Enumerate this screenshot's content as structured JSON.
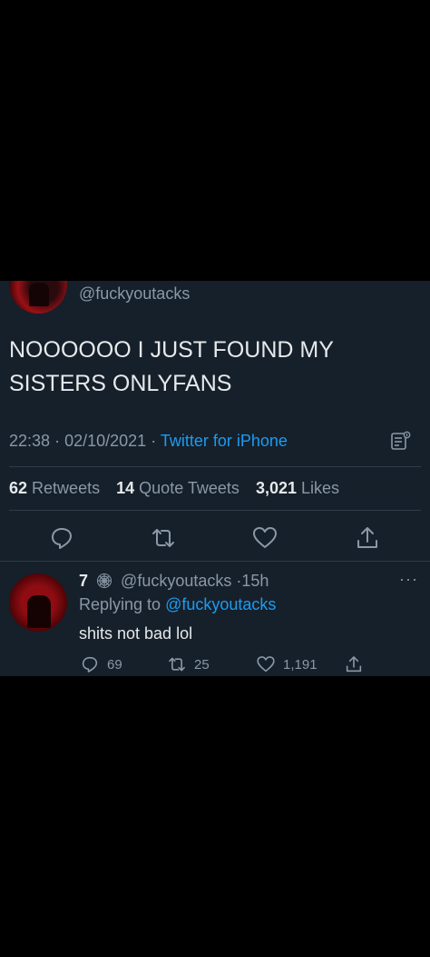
{
  "tweet": {
    "handle": "@fuckyoutacks",
    "text": "NOOOOOO I JUST FOUND MY\nSISTERS ONLYFANS",
    "time": "22:38",
    "date": "02/10/2021",
    "separator": "·",
    "source": "Twitter for iPhone",
    "stats": {
      "retweets_count": "62",
      "retweets_label": "Retweets",
      "quotes_count": "14",
      "quotes_label": "Quote Tweets",
      "likes_count": "3,021",
      "likes_label": "Likes"
    }
  },
  "reply": {
    "name": "7",
    "handle": "@fuckyoutacks",
    "age": "15h",
    "replying_prefix": "Replying to",
    "replying_to": "@fuckyoutacks",
    "text": "shits not bad lol",
    "more": "···",
    "reply_count": "69",
    "retweet_count": "25",
    "like_count": "1,191"
  },
  "icons": {
    "reply": "reply-icon",
    "retweet": "retweet-icon",
    "like": "heart-icon",
    "share": "share-icon",
    "analytics": "analytics-icon"
  },
  "colors": {
    "background": "#15202b",
    "text": "#e7e9ea",
    "muted": "#8b98a5",
    "accent": "#1d9bf0",
    "page": "#000000"
  }
}
